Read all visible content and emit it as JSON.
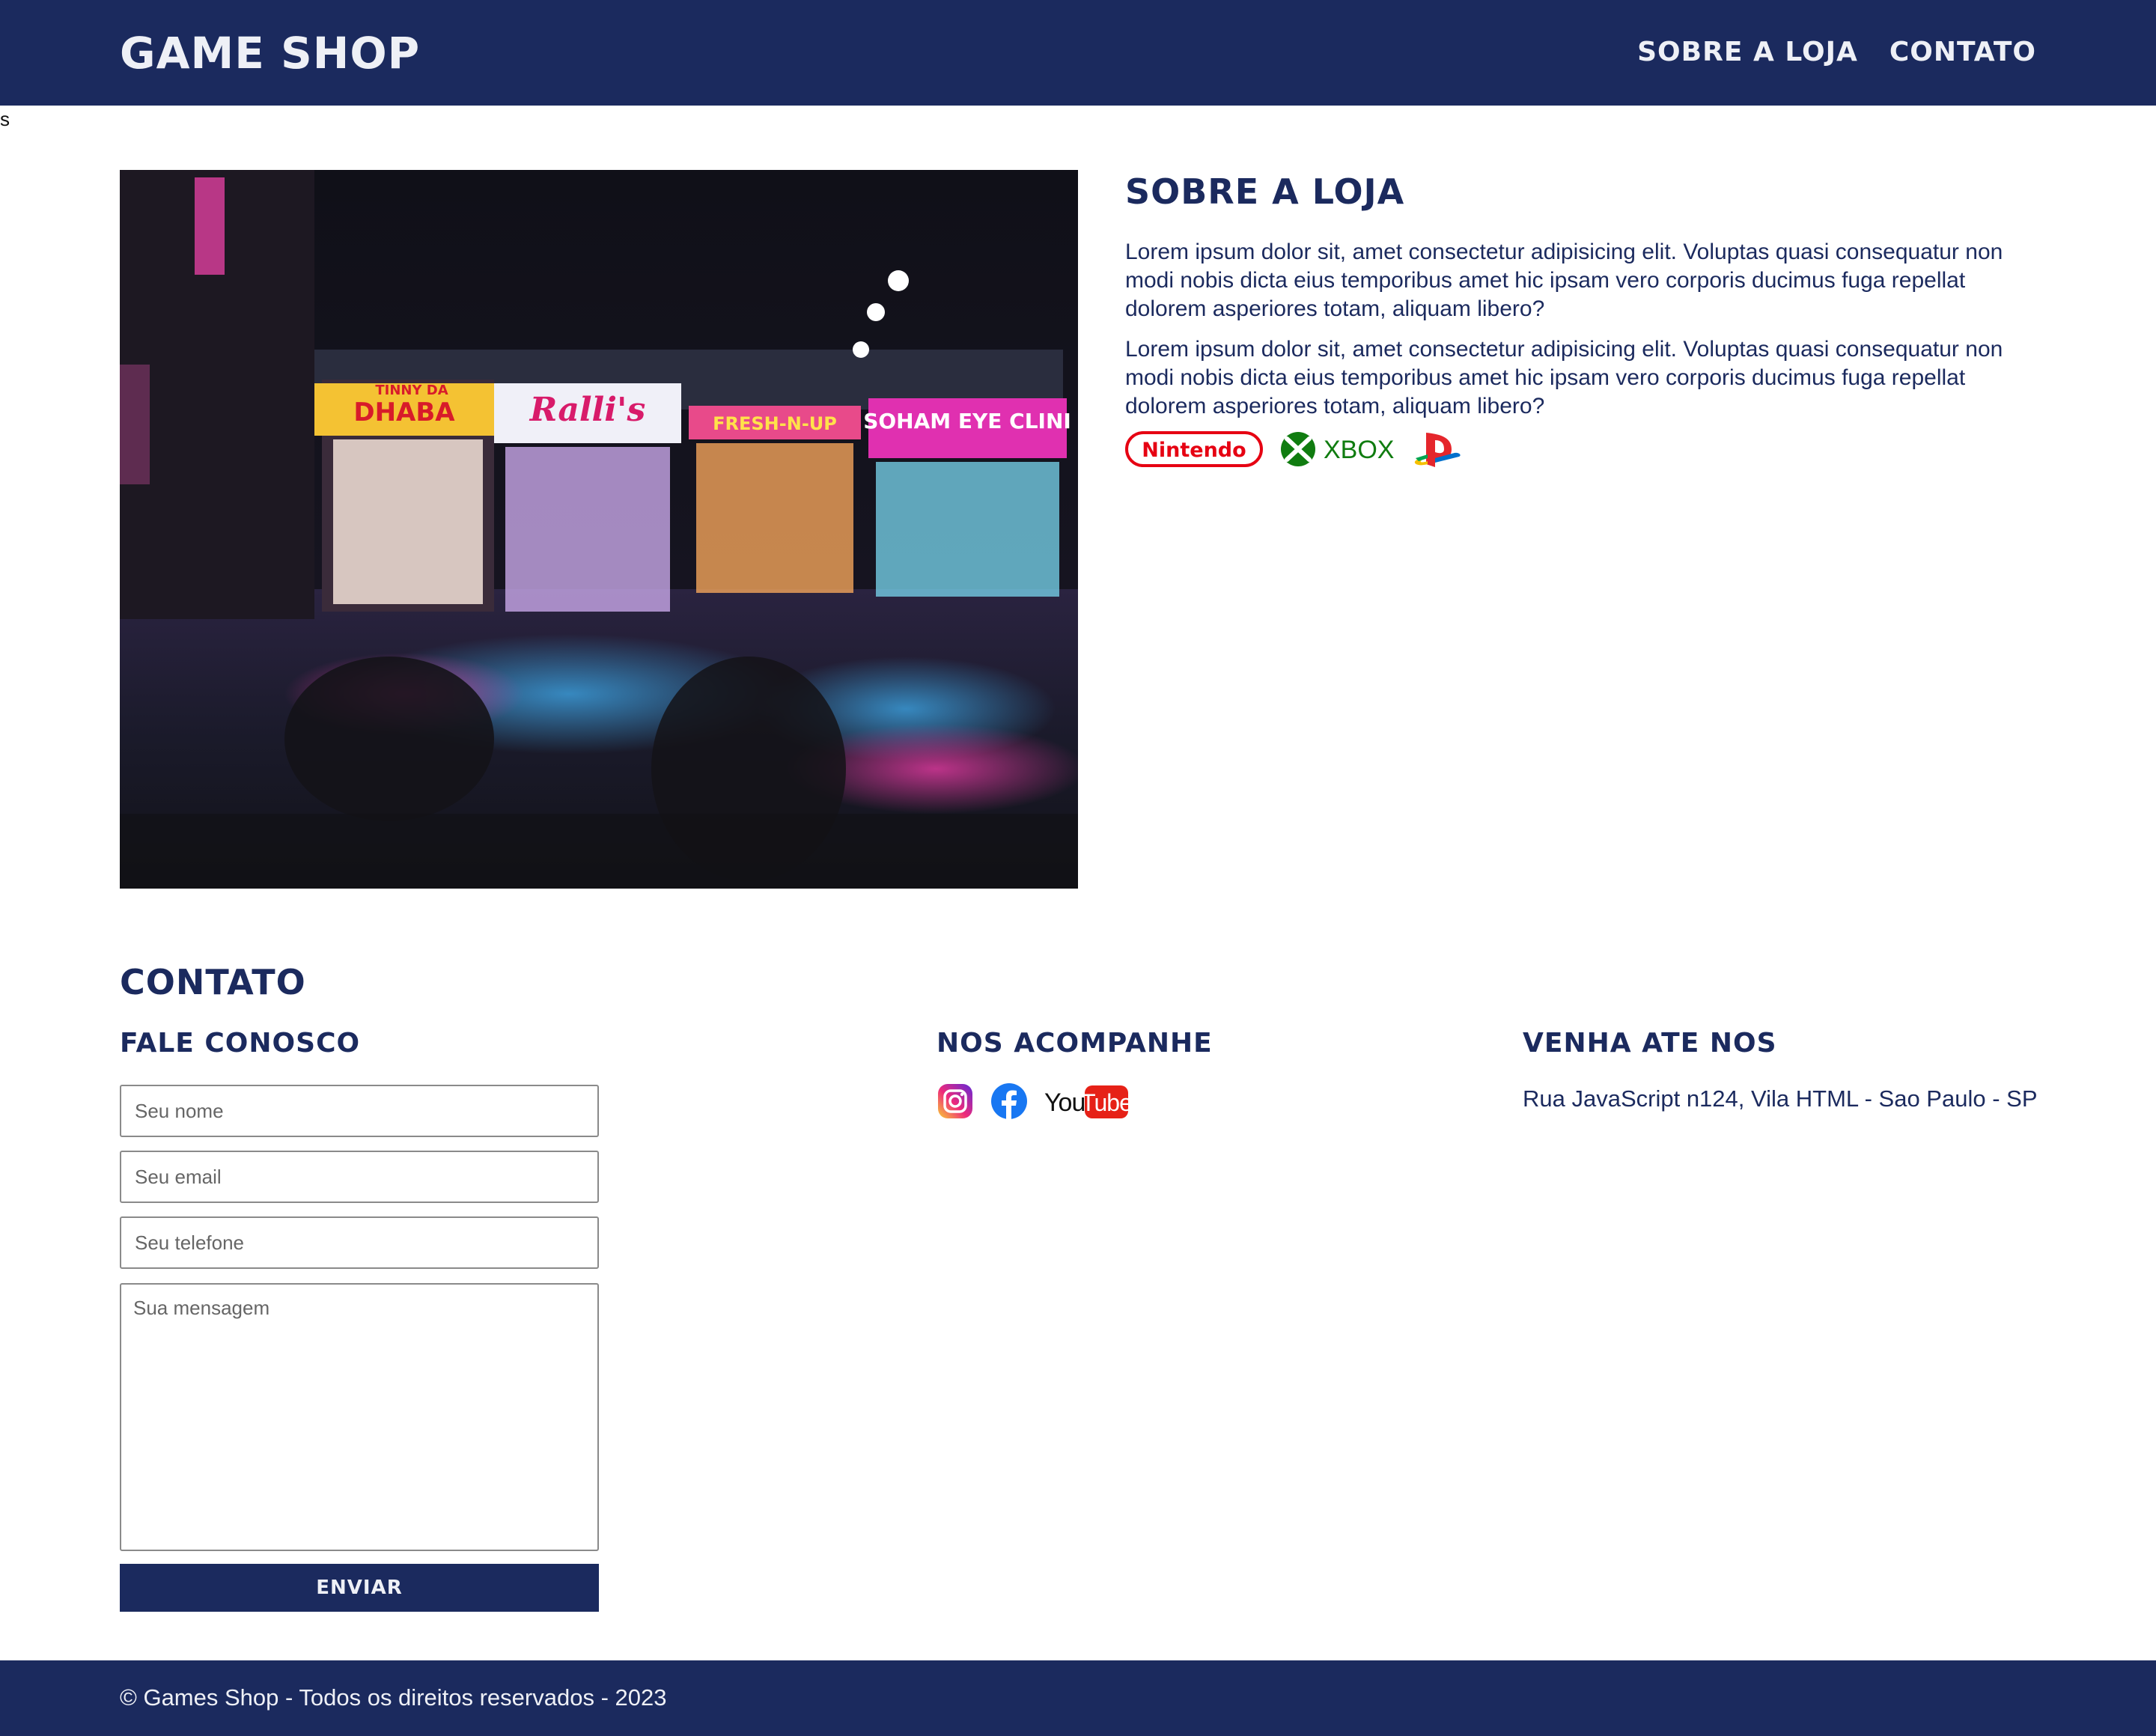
{
  "header": {
    "logo": "GAME SHOP",
    "nav": [
      "SOBRE A LOJA",
      "CONTATO"
    ]
  },
  "stray_text": "s",
  "about": {
    "title": "SOBRE A LOJA",
    "paragraphs": [
      "Lorem ipsum dolor sit, amet consectetur adipisicing elit. Voluptas quasi consequatur non modi nobis dicta eius temporibus amet hic ipsam vero corporis ducimus fuga repellat dolorem asperiores totam, aliquam libero?",
      "Lorem ipsum dolor sit, amet consectetur adipisicing elit. Voluptas quasi consequatur non modi nobis dicta eius temporibus amet hic ipsam vero corporis ducimus fuga repellat dolorem asperiores totam, aliquam libero?"
    ],
    "photo_signs": [
      "TINNY DA DHABA",
      "Ralli's",
      "FRESH-N-UP",
      "SOHAM EYE CLINI"
    ],
    "brands": [
      "Nintendo",
      "XBOX",
      "playstation-icon"
    ]
  },
  "contact": {
    "title": "CONTATO",
    "form_title": "FALE CONOSCO",
    "fields": {
      "name_placeholder": "Seu nome",
      "email_placeholder": "Seu email",
      "phone_placeholder": "Seu telefone",
      "message_placeholder": "Sua mensagem"
    },
    "submit_label": "ENVIAR",
    "social_title": "NOS ACOMPANHE",
    "social": [
      "instagram-icon",
      "facebook-icon",
      "YouTube"
    ],
    "visit_title": "VENHA ATE NOS",
    "address": "Rua JavaScript n124, Vila HTML - Sao Paulo - SP"
  },
  "footer": {
    "copyright": "© Games Shop - Todos os direitos reservados - 2023"
  },
  "colors": {
    "primary": "#1b2a5e",
    "header_text": "#eef0f6",
    "nintendo_red": "#e60012",
    "xbox_green": "#107c10",
    "youtube_red": "#e62117",
    "facebook_blue": "#1877f2"
  }
}
